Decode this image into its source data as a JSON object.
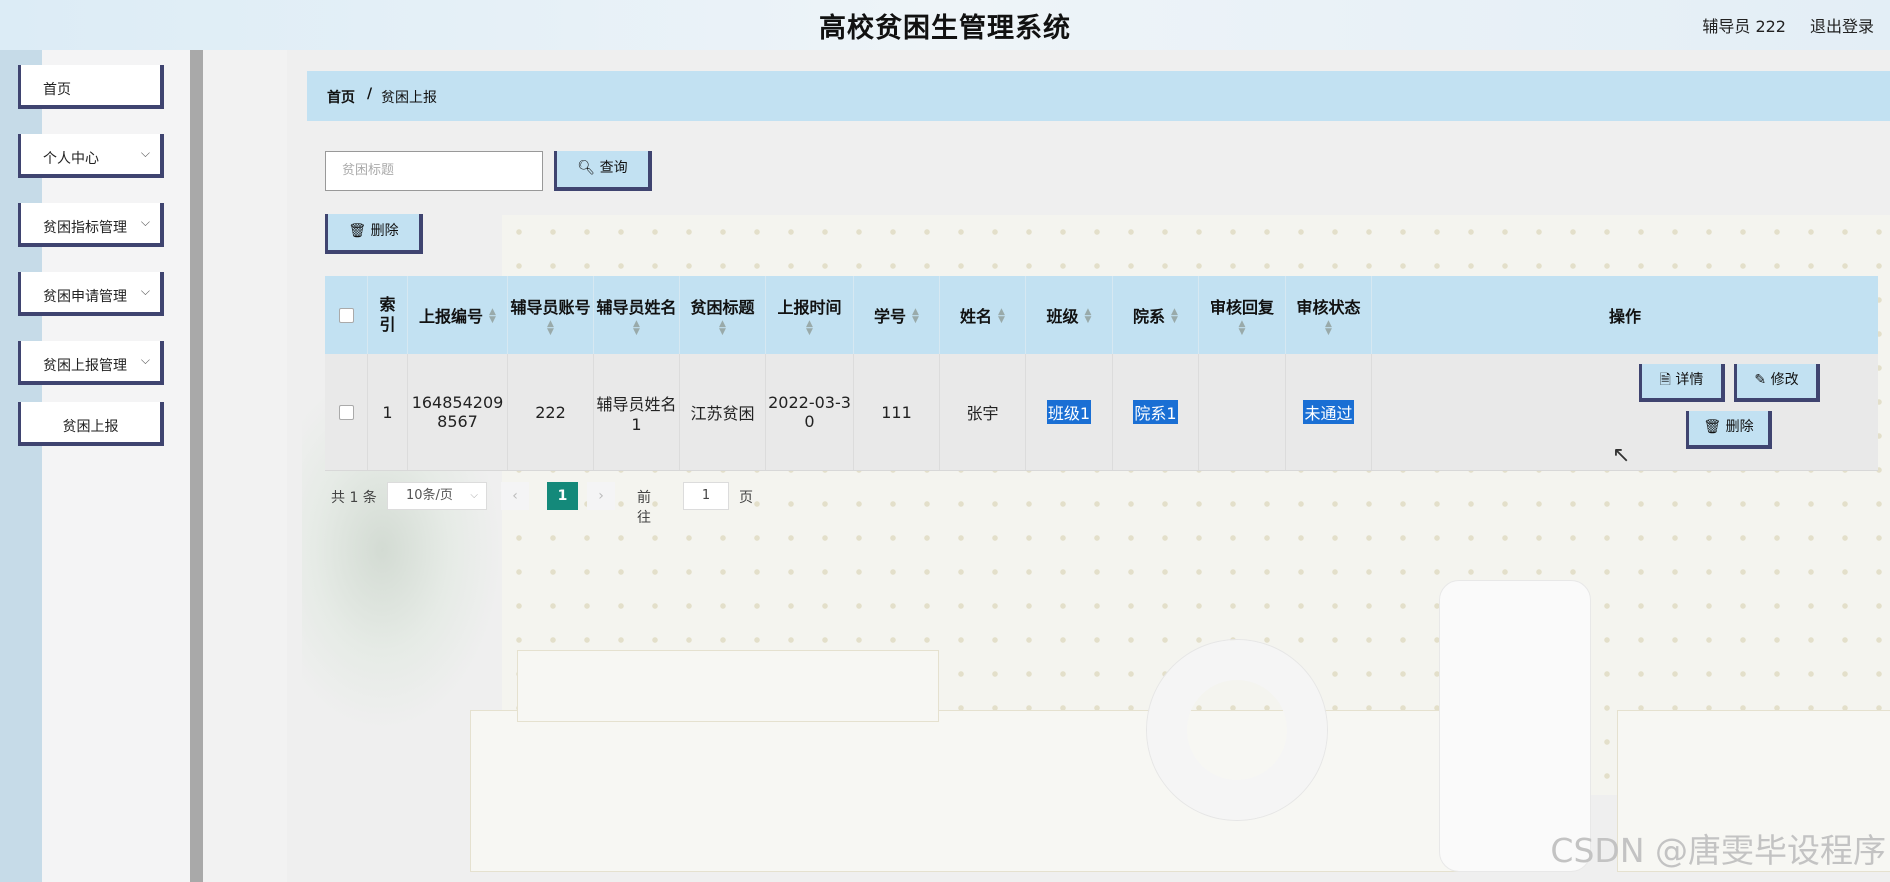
{
  "header": {
    "title": "高校贫困生管理系统",
    "user": "辅导员 222",
    "logout": "退出登录"
  },
  "sidebar": {
    "items": [
      {
        "label": "首页",
        "has_children": false
      },
      {
        "label": "个人中心",
        "has_children": true
      },
      {
        "label": "贫困指标管理",
        "has_children": true
      },
      {
        "label": "贫困申请管理",
        "has_children": true
      },
      {
        "label": "贫困上报管理",
        "has_children": true
      },
      {
        "label": "贫困上报",
        "has_children": false
      }
    ],
    "chevron": "⌵"
  },
  "breadcrumb": {
    "home": "首页",
    "separator": "/",
    "current": "贫困上报"
  },
  "search": {
    "placeholder": "贫困标题",
    "button_label": "查询",
    "button_icon": "search-icon"
  },
  "toolbar": {
    "delete_label": "删除",
    "delete_icon": "trash-icon"
  },
  "table": {
    "headers": [
      "索引",
      "上报编号",
      "辅导员账号",
      "辅导员姓名",
      "贫困标题",
      "上报时间",
      "学号",
      "姓名",
      "班级",
      "院系",
      "审核回复",
      "审核状态",
      "操作"
    ],
    "rows": [
      {
        "index": "1",
        "report_no_line1": "164854209",
        "report_no_line2": "8567",
        "counselor_account": "222",
        "counselor_name_line1": "辅导员姓名",
        "counselor_name_line2": "1",
        "title": "江苏贫困",
        "time_line1": "2022-03-3",
        "time_line2": "0",
        "student_no": "111",
        "name": "张宇",
        "class": "班级1",
        "department": "院系1",
        "reply": "",
        "status": "未通过"
      }
    ],
    "actions": {
      "detail": "详情",
      "edit": "修改",
      "delete": "删除"
    }
  },
  "pagination": {
    "total": "共 1 条",
    "page_size": "10条/页",
    "current_page": "1",
    "goto_label": "前往",
    "goto_value": "1",
    "page_unit": "页",
    "prev": "‹",
    "next": "›"
  },
  "watermark": "CSDN @唐雯毕设程序",
  "colors": {
    "accent": "#c2e1f2",
    "border_dark": "#3f4470",
    "page_active": "#14897a",
    "selection": "#1a6fd4"
  }
}
